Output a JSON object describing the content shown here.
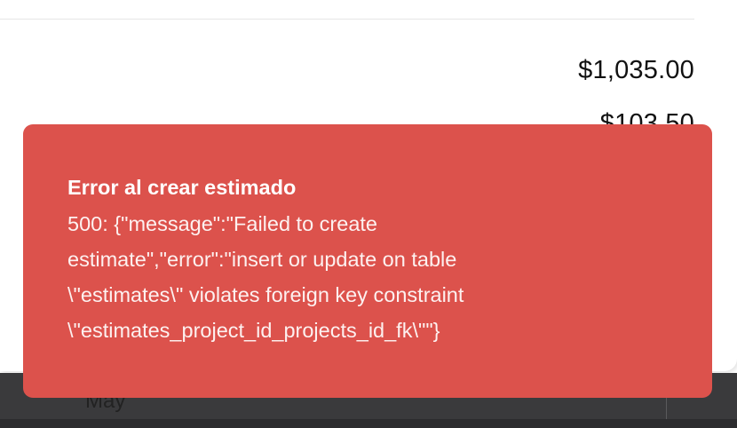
{
  "background": {
    "amounts": [
      "$1,035.00",
      "$103.50"
    ],
    "month_label": "May"
  },
  "toast": {
    "variant": "error",
    "background_color": "#dc524c",
    "title": "Error al crear estimado",
    "message": "500: {\"message\":\"Failed to create estimate\",\"error\":\"insert or update on table \\\"estimates\\\" violates foreign key constraint \\\"estimates_project_id_projects_id_fk\\\"\"}"
  }
}
